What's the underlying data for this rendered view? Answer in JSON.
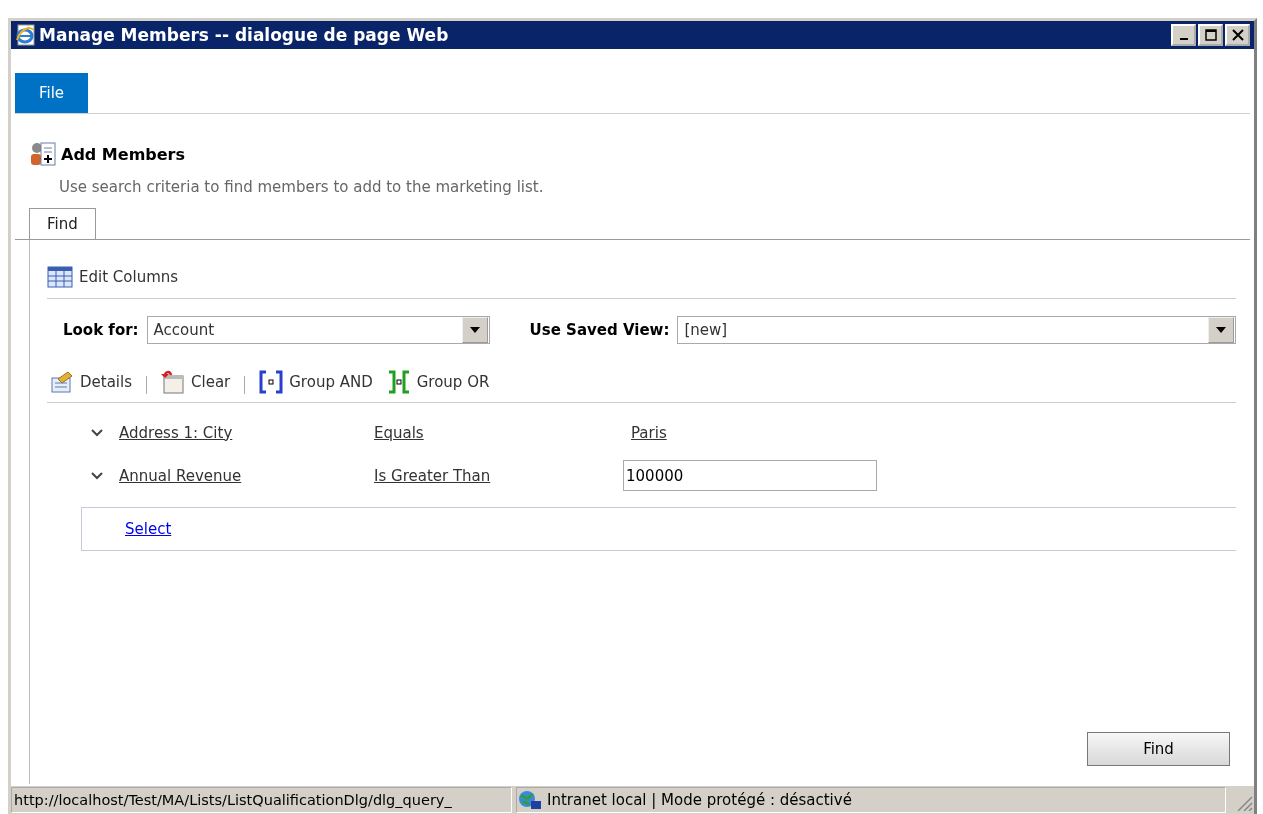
{
  "window": {
    "title": "Manage Members -- dialogue de page Web"
  },
  "ribbon_tabs": [
    {
      "label": "File",
      "selected": true
    }
  ],
  "section": {
    "title": "Add Members",
    "description": "Use search criteria to find members to add to the marketing list."
  },
  "tabs": [
    {
      "label": "Find",
      "selected": true
    }
  ],
  "edit_columns": "Edit Columns",
  "look_for": {
    "label": "Look for:",
    "value": "Account"
  },
  "saved_view": {
    "label": "Use Saved View:",
    "value": "[new]"
  },
  "actions": [
    {
      "kind": "details",
      "label": "Details"
    },
    {
      "kind": "clear",
      "label": "Clear"
    },
    {
      "kind": "and",
      "label": "Group AND"
    },
    {
      "kind": "or",
      "label": "Group OR"
    }
  ],
  "conditions": [
    {
      "field": "Address 1: City",
      "operator": "Equals",
      "value": "Paris",
      "kind": "link"
    },
    {
      "field": "Annual Revenue",
      "operator": "Is Greater Than",
      "value": "100000",
      "kind": "input"
    }
  ],
  "select_link": "Select",
  "find_button": "Find",
  "status_bar": {
    "url": "http://localhost/Test/MA/Lists/ListQualificationDlg/dlg_query_",
    "zone": "Intranet local | Mode protégé : désactivé"
  }
}
